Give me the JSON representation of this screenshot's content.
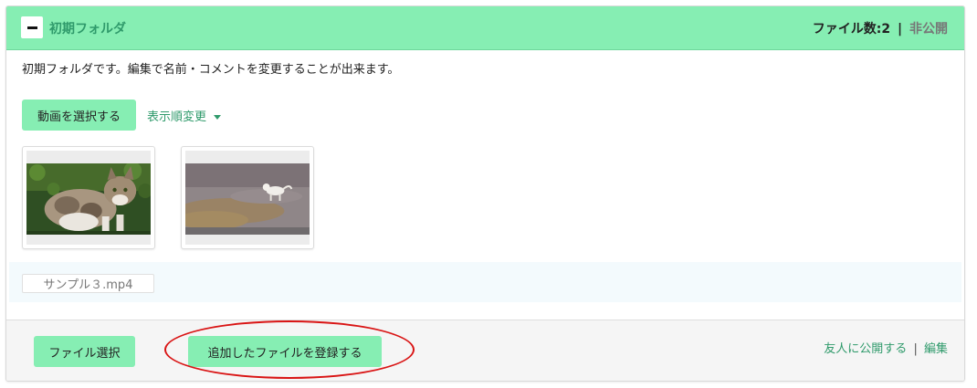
{
  "header": {
    "title": "初期フォルダ",
    "file_count": "ファイル数:2",
    "separator": "|",
    "visibility": "非公開"
  },
  "description": "初期フォルダです。編集で名前・コメントを変更することが出来ます。",
  "actions": {
    "select_video_label": "動画を選択する",
    "sort_order_label": "表示順変更"
  },
  "thumbnails": [
    {
      "subject": "cat sitting in front of green leaves"
    },
    {
      "subject": "white cat walking on a dirt path"
    }
  ],
  "upload": {
    "pending_file": "サンプル３.mp4"
  },
  "footer": {
    "file_select_label": "ファイル選択",
    "register_label": "追加したファイルを登録する",
    "share_label": "友人に公開する",
    "separator": "|",
    "edit_label": "編集"
  },
  "colors": {
    "accent": "#86eeb3",
    "accent_text": "#2f9a6b",
    "annotation": "#d91414"
  }
}
